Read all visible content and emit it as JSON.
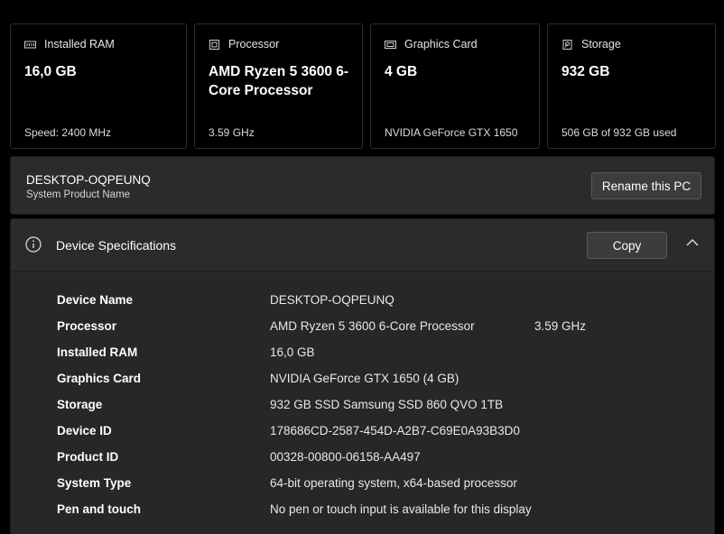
{
  "cards": [
    {
      "icon": "ram-icon",
      "title": "Installed RAM",
      "value": "16,0 GB",
      "sub": "Speed: 2400 MHz"
    },
    {
      "icon": "processor-icon",
      "title": "Processor",
      "value": "AMD Ryzen 5 3600 6-Core Processor",
      "sub": "3.59 GHz"
    },
    {
      "icon": "graphics-card-icon",
      "title": "Graphics Card",
      "value": "4 GB",
      "sub": "NVIDIA GeForce GTX 1650"
    },
    {
      "icon": "storage-icon",
      "title": "Storage",
      "value": "932 GB",
      "sub": "506 GB of 932 GB used"
    }
  ],
  "pc": {
    "name": "DESKTOP-OQPEUNQ",
    "sub": "System Product Name",
    "rename_label": "Rename this PC"
  },
  "spec": {
    "title": "Device Specifications",
    "copy_label": "Copy",
    "rows": [
      {
        "label": "Device Name",
        "value": "DESKTOP-OQPEUNQ",
        "extra": ""
      },
      {
        "label": "Processor",
        "value": "AMD Ryzen 5 3600 6-Core Processor",
        "extra": "3.59 GHz"
      },
      {
        "label": "Installed RAM",
        "value": "16,0 GB",
        "extra": ""
      },
      {
        "label": "Graphics Card",
        "value": "NVIDIA GeForce GTX 1650 (4 GB)",
        "extra": ""
      },
      {
        "label": "Storage",
        "value": "932 GB SSD Samsung SSD 860 QVO 1TB",
        "extra": ""
      },
      {
        "label": "Device ID",
        "value": "178686CD-2587-454D-A2B7-C69E0A93B3D0",
        "extra": ""
      },
      {
        "label": "Product ID",
        "value": "00328-00800-06158-AA497",
        "extra": ""
      },
      {
        "label": "System Type",
        "value": "64-bit operating system, x64-based processor",
        "extra": ""
      },
      {
        "label": "Pen and touch",
        "value": "No pen or touch input is available for this display",
        "extra": ""
      }
    ]
  },
  "colors": {
    "background": "#000000",
    "panel": "#2b2b2b",
    "button": "#3c3c3c"
  }
}
